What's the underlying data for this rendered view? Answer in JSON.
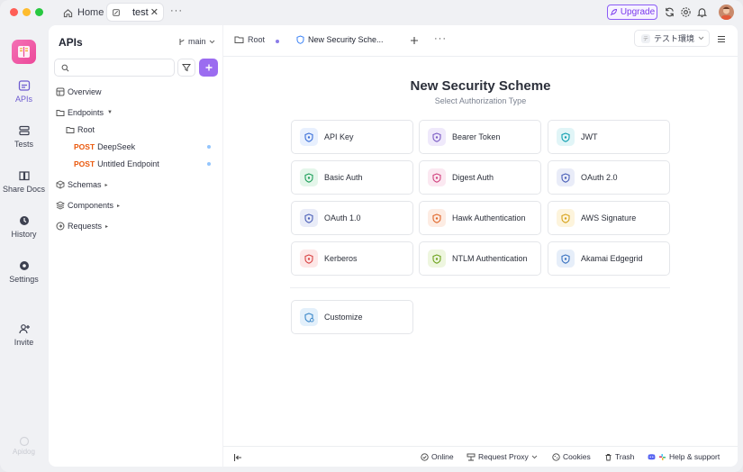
{
  "titlebar": {
    "home_tab": "Home",
    "test_tab": "test",
    "close_glyph": "✕",
    "more_glyph": "···",
    "upgrade_label": "Upgrade",
    "traffic_colors": [
      "#ff5f57",
      "#febc2e",
      "#28c840"
    ]
  },
  "rail": {
    "items": [
      {
        "label": "APIs",
        "icon": "apis-icon"
      },
      {
        "label": "Tests",
        "icon": "tests-icon"
      },
      {
        "label": "Share Docs",
        "icon": "share-docs-icon"
      },
      {
        "label": "History",
        "icon": "history-icon"
      },
      {
        "label": "Settings",
        "icon": "settings-icon"
      },
      {
        "label": "Invite",
        "icon": "invite-icon"
      }
    ],
    "footer_label": "Apidog"
  },
  "sidebar": {
    "title": "APIs",
    "branch": "main",
    "tree": {
      "overview": "Overview",
      "endpoints": "Endpoints",
      "root": "Root",
      "endpoint_1": {
        "method": "POST",
        "name": "DeepSeek"
      },
      "endpoint_2": {
        "method": "POST",
        "name": "Untitled Endpoint"
      },
      "schemas": "Schemas",
      "components": "Components",
      "requests": "Requests"
    }
  },
  "main": {
    "tabs": {
      "root": "Root",
      "active": "New Security Sche..."
    },
    "env_label": "テスト環境",
    "env_badge": "テ",
    "title": "New Security Scheme",
    "subtitle": "Select Authorization Type",
    "cards": {
      "api_key": "API Key",
      "bearer_token": "Bearer Token",
      "jwt": "JWT",
      "basic_auth": "Basic Auth",
      "digest_auth": "Digest Auth",
      "oauth2": "OAuth 2.0",
      "oauth1": "OAuth 1.0",
      "hawk": "Hawk Authentication",
      "aws": "AWS Signature",
      "kerberos": "Kerberos",
      "ntlm": "NTLM Authentication",
      "akamai": "Akamai Edgegrid",
      "customize": "Customize"
    }
  },
  "statusbar": {
    "online": "Online",
    "request_proxy": "Request Proxy",
    "cookies": "Cookies",
    "trash": "Trash",
    "help": "Help & support"
  },
  "colors": {
    "accent": "#9b6cf0",
    "method_post": "#ea580c"
  }
}
